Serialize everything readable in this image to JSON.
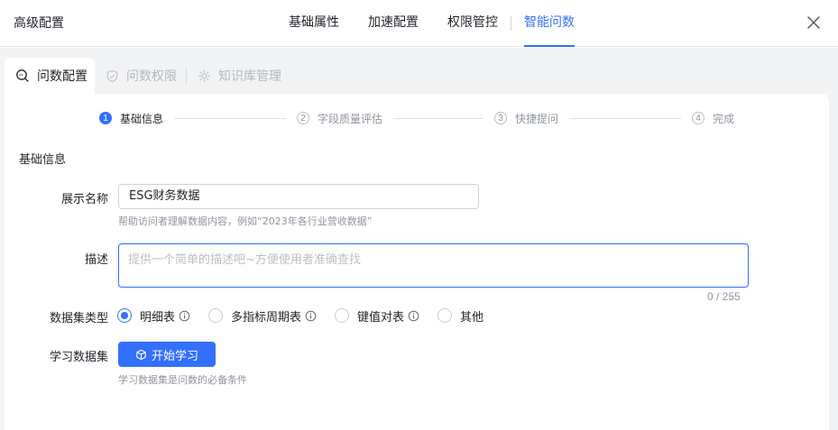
{
  "header": {
    "title": "高级配置",
    "tabs": [
      {
        "label": "基础属性"
      },
      {
        "label": "加速配置"
      },
      {
        "label": "权限管控"
      },
      {
        "label": "智能问数"
      }
    ],
    "active_tab": "智能问数"
  },
  "sub_tabs": [
    {
      "label": "问数配置",
      "icon": "chat-bubble-icon"
    },
    {
      "label": "问数权限",
      "icon": "shield-check-icon"
    },
    {
      "label": "知识库管理",
      "icon": "knowledge-gear-icon"
    }
  ],
  "steps": [
    {
      "num": "1",
      "label": "基础信息"
    },
    {
      "num": "2",
      "label": "字段质量评估"
    },
    {
      "num": "3",
      "label": "快捷提问"
    },
    {
      "num": "4",
      "label": "完成"
    }
  ],
  "form": {
    "section_title": "基础信息",
    "display_name": {
      "label": "展示名称",
      "value": "ESG财务数据",
      "hint": "帮助访问者理解数据内容，例如“2023年各行业营收数据”"
    },
    "description": {
      "label": "描述",
      "placeholder": "提供一个简单的描述吧~方便使用者准确查找",
      "counter": "0 / 255"
    },
    "dataset_type": {
      "label": "数据集类型",
      "options": [
        {
          "label": "明细表",
          "checked": true,
          "info": true
        },
        {
          "label": "多指标周期表",
          "checked": false,
          "info": true
        },
        {
          "label": "键值对表",
          "checked": false,
          "info": true
        },
        {
          "label": "其他",
          "checked": false,
          "info": false
        }
      ]
    },
    "learn": {
      "label": "学习数据集",
      "button": "开始学习",
      "hint": "学习数据集是问数的必备条件"
    }
  },
  "colors": {
    "accent": "#3370ff",
    "body_bg": "#f2f3f5",
    "muted": "#8f959e"
  }
}
